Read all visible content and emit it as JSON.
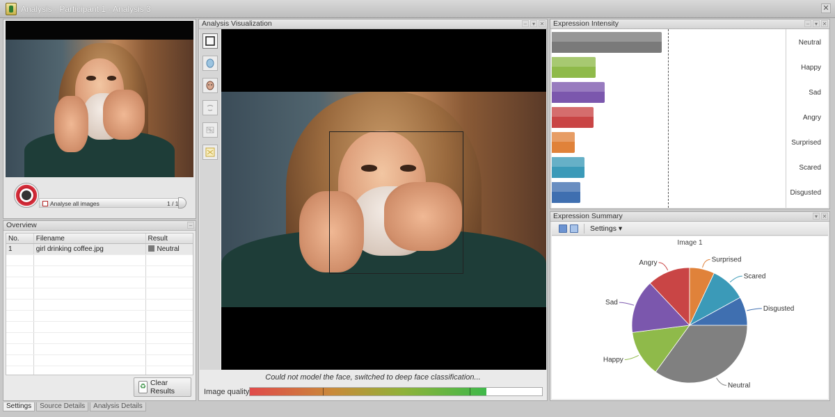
{
  "window": {
    "title": "Analysis - Participant 1 - Analysis 3",
    "close_glyph": "✕"
  },
  "preview": {
    "analyse_all_label": "Analyse all images",
    "counter": "1 / 1"
  },
  "overview": {
    "title": "Overview",
    "columns": [
      "No.",
      "Filename",
      "Result"
    ],
    "rows": [
      {
        "no": "1",
        "filename": "girl drinking coffee.jpg",
        "result": "Neutral"
      }
    ],
    "clear_button": "Clear Results"
  },
  "bottom_tabs": [
    "Settings",
    "Source Details",
    "Analysis Details"
  ],
  "visualization": {
    "title": "Analysis Visualization",
    "status_message": "Could not model the face, switched to deep face classification...",
    "quality_label": "Image quality",
    "quality_fraction": 0.81,
    "tools": [
      "box-icon",
      "face-mask-icon",
      "face-texture-icon",
      "face-outline-icon",
      "face-mesh-icon",
      "landmarks-icon"
    ]
  },
  "intensity": {
    "title": "Expression Intensity",
    "max_value": 1.0,
    "items": [
      {
        "label": "Neutral",
        "value": 0.85,
        "color": "#7a7a7a"
      },
      {
        "label": "Happy",
        "value": 0.34,
        "color": "#8fba4a"
      },
      {
        "label": "Sad",
        "value": 0.41,
        "color": "#7b57ad"
      },
      {
        "label": "Angry",
        "value": 0.32,
        "color": "#c94545"
      },
      {
        "label": "Surprised",
        "value": 0.18,
        "color": "#e0823a"
      },
      {
        "label": "Scared",
        "value": 0.25,
        "color": "#3b9ab8"
      },
      {
        "label": "Disgusted",
        "value": 0.22,
        "color": "#3f6fb0"
      }
    ]
  },
  "summary": {
    "title": "Expression Summary",
    "settings_label": "Settings",
    "chart_title": "Image 1"
  },
  "chart_data": {
    "type": "pie",
    "title": "Image 1",
    "slices": [
      {
        "name": "Neutral",
        "value": 35,
        "color": "#808080"
      },
      {
        "name": "Happy",
        "value": 13,
        "color": "#8fba4a"
      },
      {
        "name": "Sad",
        "value": 15,
        "color": "#7b57ad"
      },
      {
        "name": "Angry",
        "value": 12,
        "color": "#c94545"
      },
      {
        "name": "Surprised",
        "value": 7,
        "color": "#e0823a"
      },
      {
        "name": "Scared",
        "value": 10,
        "color": "#3b9ab8"
      },
      {
        "name": "Disgusted",
        "value": 8,
        "color": "#3f6fb0"
      }
    ]
  }
}
